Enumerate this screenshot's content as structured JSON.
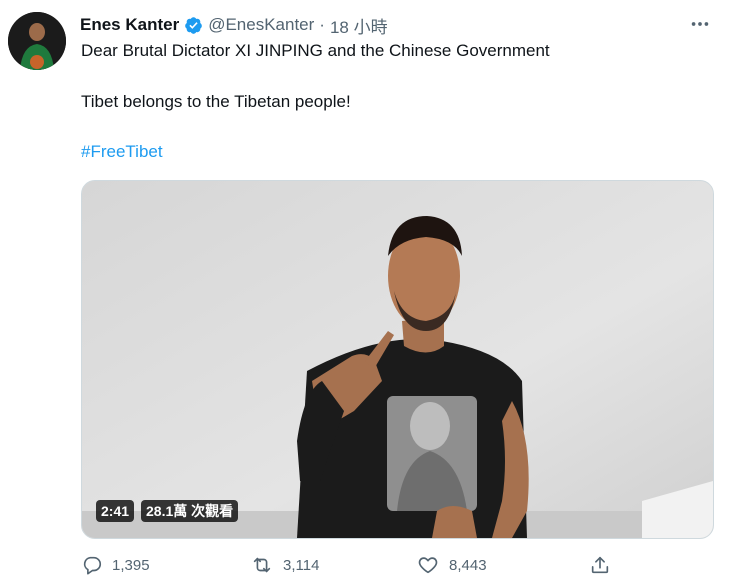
{
  "tweet": {
    "author_name": "Enes Kanter",
    "handle": "@EnesKanter",
    "separator": "·",
    "time": "18 小時",
    "line1": "Dear Brutal Dictator XI JINPING and the Chinese Government",
    "line2": "Tibet belongs to the Tibetan people!",
    "hashtag": "#FreeTibet"
  },
  "video": {
    "duration": "2:41",
    "views": "28.1萬 次觀看"
  },
  "actions": {
    "replies": "1,395",
    "retweets": "3,114",
    "likes": "8,443"
  },
  "icons": {
    "verified": "verified-badge-icon",
    "more": "more-icon",
    "reply": "reply-icon",
    "retweet": "retweet-icon",
    "like": "like-icon",
    "share": "share-icon"
  },
  "colors": {
    "accent": "#1d9bf0",
    "muted": "#536471",
    "text": "#0f1419"
  }
}
